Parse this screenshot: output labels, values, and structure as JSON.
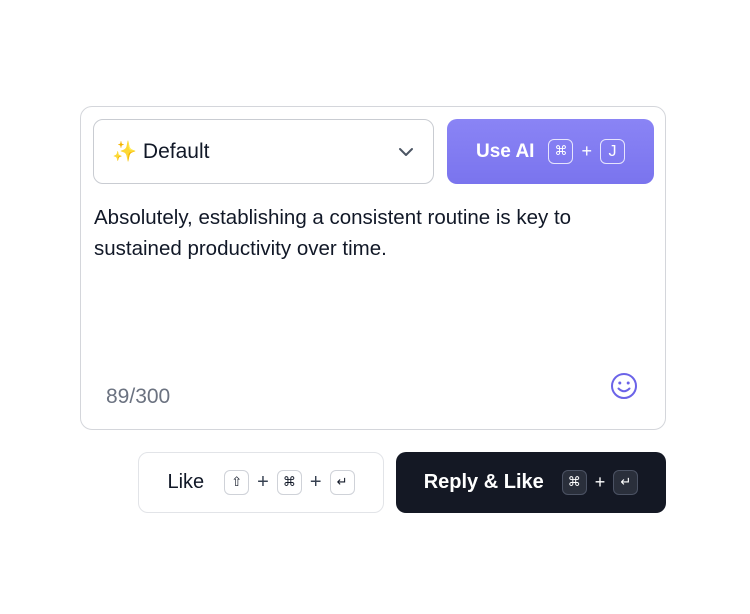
{
  "composer": {
    "tone_select": {
      "icon": "sparkles-icon",
      "value": "Default"
    },
    "use_ai_button": {
      "label": "Use AI",
      "keys": [
        "⌘",
        "+",
        "J"
      ]
    },
    "reply_text": "Absolutely, establishing a consistent routine is key to sustained productivity over time.",
    "char_counter": "89/300",
    "emoji_icon": "smiley-face-icon"
  },
  "actions": {
    "like_button": {
      "label": "Like",
      "keys": [
        "⇧",
        "+",
        "⌘",
        "+",
        "↵"
      ]
    },
    "reply_like_button": {
      "label": "Reply & Like",
      "keys": [
        "⌘",
        "+",
        "↵"
      ]
    }
  },
  "colors": {
    "ai_accent": "#7a74ee",
    "dark_button": "#141824",
    "emoji_icon": "#6b63e8",
    "counter_text": "#6b7280"
  }
}
